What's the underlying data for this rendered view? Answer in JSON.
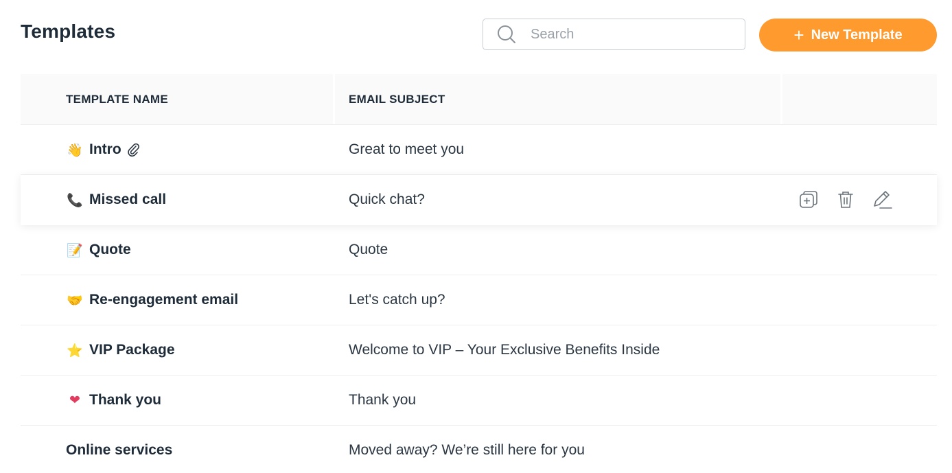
{
  "header": {
    "title": "Templates",
    "search_placeholder": "Search",
    "new_button_label": "New Template"
  },
  "table": {
    "columns": [
      "TEMPLATE NAME",
      "EMAIL SUBJECT"
    ],
    "rows": [
      {
        "emoji": "👋",
        "name": "Intro",
        "subject": "Great to meet you",
        "attachment": true
      },
      {
        "emoji": "📞",
        "name": "Missed call",
        "subject": "Quick chat?"
      },
      {
        "emoji": "📝",
        "name": "Quote",
        "subject": "Quote"
      },
      {
        "emoji": "🤝",
        "name": "Re-engagement email",
        "subject": "Let's catch up?"
      },
      {
        "emoji": "⭐",
        "name": "VIP Package",
        "subject": "Welcome to VIP – Your Exclusive Benefits Inside"
      },
      {
        "emoji": "❤",
        "name": "Thank you",
        "subject": "Thank you"
      },
      {
        "emoji": "",
        "name": "Online services",
        "subject": "Moved away? We’re still here for you"
      }
    ]
  },
  "icons": {
    "search": "search-icon",
    "plus": "plus-icon",
    "attachment": "paperclip-icon",
    "duplicate": "duplicate-icon",
    "delete": "trash-icon",
    "edit": "pencil-icon"
  },
  "colors": {
    "accent": "#ff9a2e",
    "text": "#1e2b38",
    "header_bg": "#fafafa"
  }
}
